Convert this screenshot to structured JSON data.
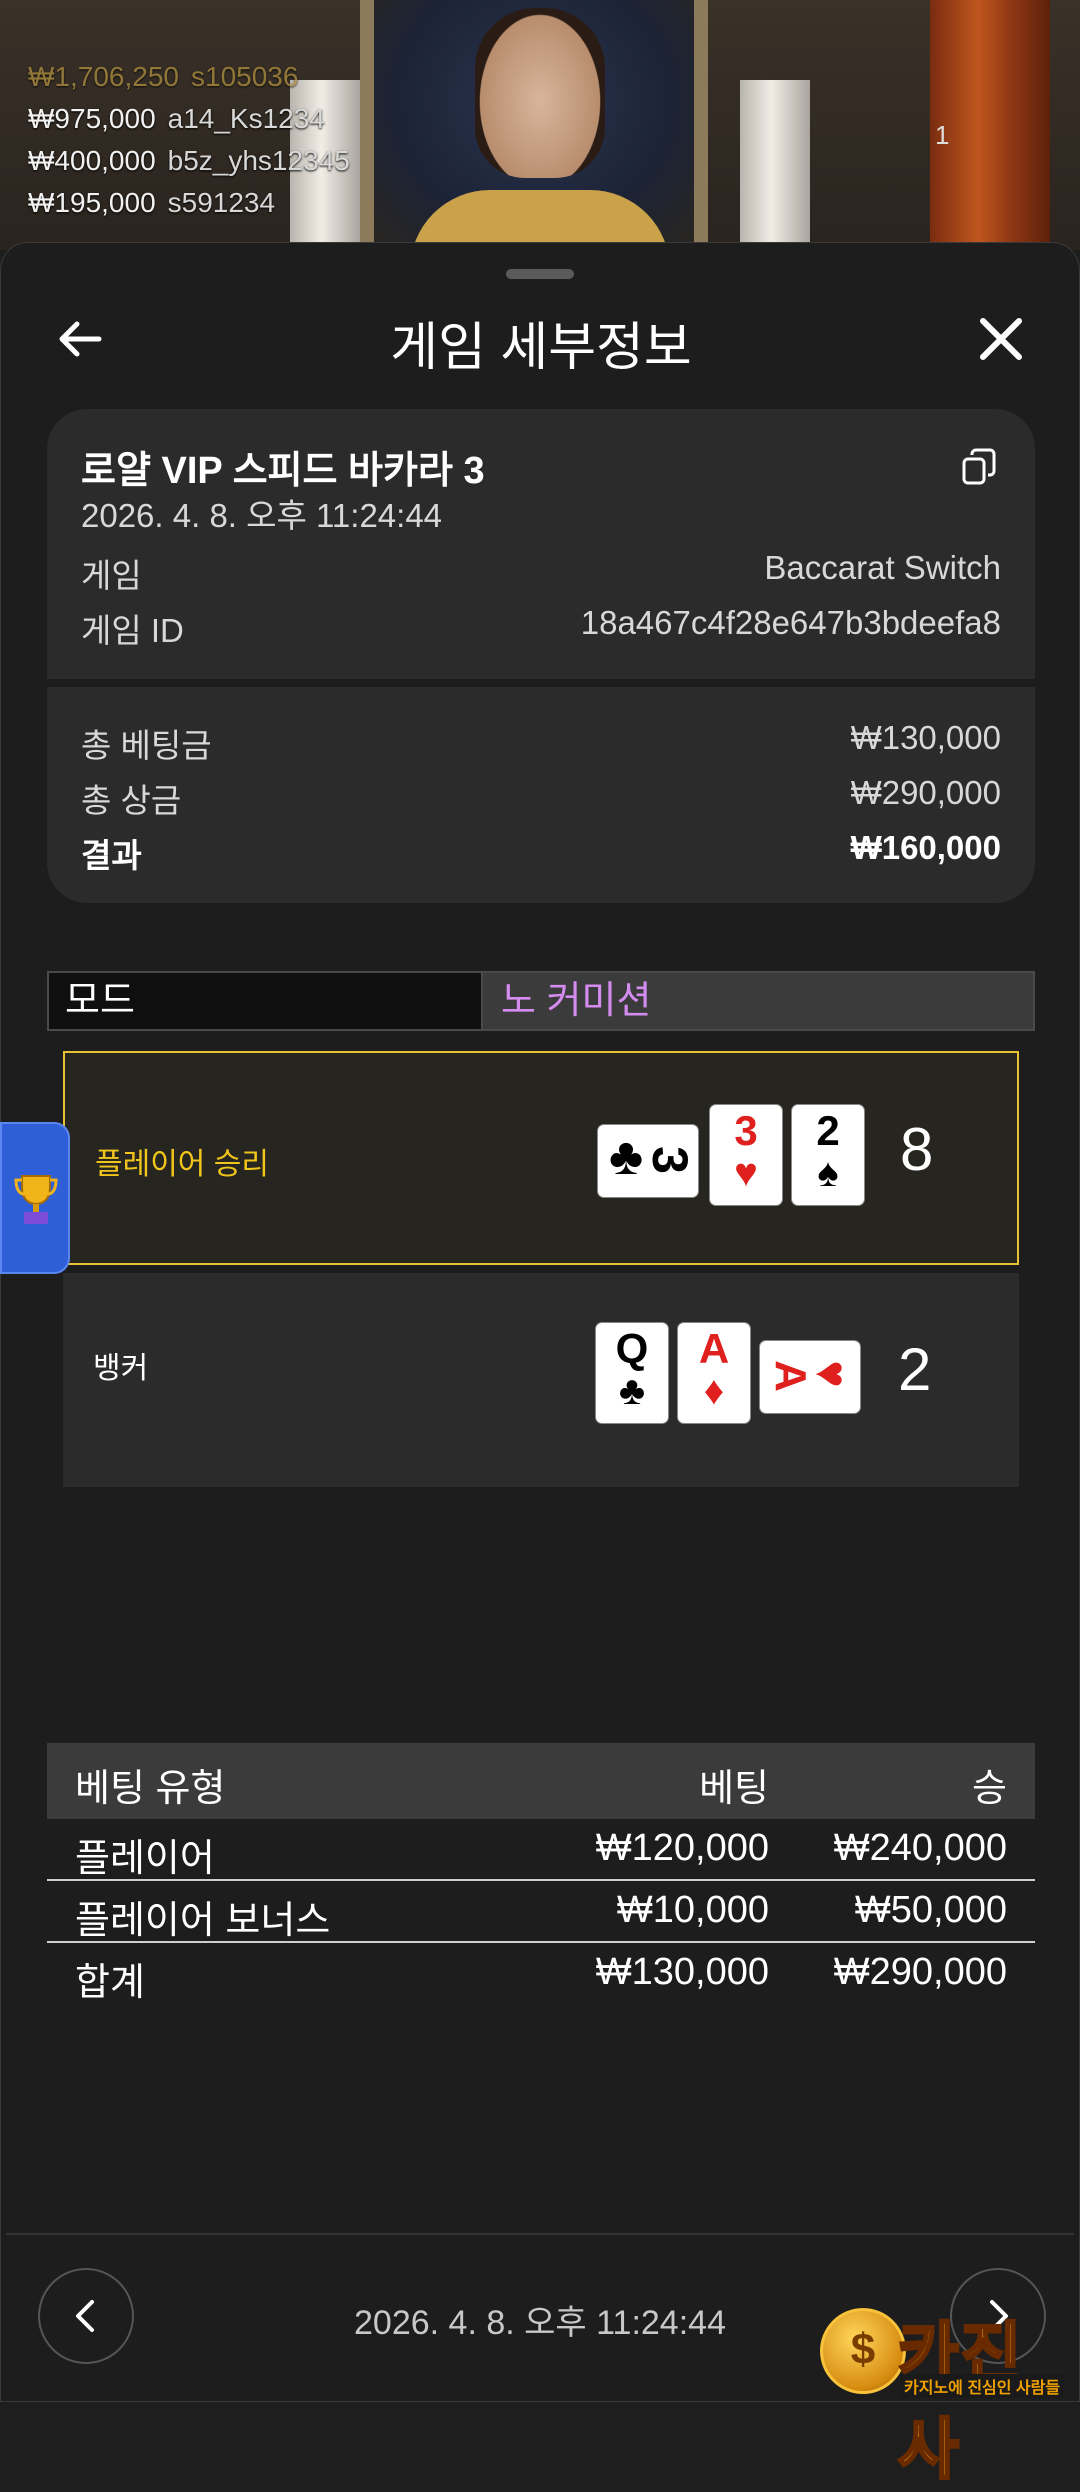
{
  "stream": {
    "bets": [
      {
        "amount": "₩1,706,250",
        "name": "s105036"
      },
      {
        "amount": "₩975,000",
        "name": "a14_Ks1234"
      },
      {
        "amount": "₩400,000",
        "name": "b5z_yhs12345"
      },
      {
        "amount": "₩195,000",
        "name": "s591234"
      }
    ],
    "count": "1"
  },
  "header": {
    "title": "게임 세부정보"
  },
  "summary": {
    "table_name": "로얄 VIP 스피드 바카라 3",
    "datetime": "2026. 4. 8. 오후 11:24:44",
    "game_label": "게임",
    "game_value": "Baccarat Switch",
    "game_id_label": "게임 ID",
    "game_id_value": "18a467c4f28e647b3bdeefa8",
    "total_bet_label": "총 베팅금",
    "total_bet_value": "₩130,000",
    "total_win_label": "총 상금",
    "total_win_value": "₩290,000",
    "result_label": "결과",
    "result_value": "₩160,000"
  },
  "mode": {
    "label": "모드",
    "value": "노 커미션"
  },
  "hands": {
    "player": {
      "label": "플레이어 승리",
      "score": "8",
      "cards": [
        {
          "rank": "3",
          "suit": "♣",
          "color": "black",
          "rotated": true
        },
        {
          "rank": "3",
          "suit": "♥",
          "color": "red"
        },
        {
          "rank": "2",
          "suit": "♠",
          "color": "black"
        }
      ]
    },
    "banker": {
      "label": "뱅커",
      "score": "2",
      "cards": [
        {
          "rank": "Q",
          "suit": "♣",
          "color": "black"
        },
        {
          "rank": "A",
          "suit": "♦",
          "color": "red"
        },
        {
          "rank": "A",
          "suit": "♥",
          "color": "red",
          "rotated": true
        }
      ]
    }
  },
  "bets_table": {
    "headers": {
      "type": "베팅 유형",
      "bet": "베팅",
      "win": "승"
    },
    "rows": [
      {
        "type": "플레이어",
        "bet": "₩120,000",
        "win": "₩240,000"
      },
      {
        "type": "플레이어 보너스",
        "bet": "₩10,000",
        "win": "₩50,000"
      }
    ],
    "total": {
      "type": "합계",
      "bet": "₩130,000",
      "win": "₩290,000"
    }
  },
  "footer": {
    "datetime": "2026. 4. 8. 오후 11:24:44"
  },
  "watermark": {
    "word": "카진사",
    "tagline": "카지노에 진심인 사람들"
  },
  "colors": {
    "accent_gold": "#e8c234",
    "mode_purple": "#d48cf0",
    "red_suit": "#e0201f"
  }
}
